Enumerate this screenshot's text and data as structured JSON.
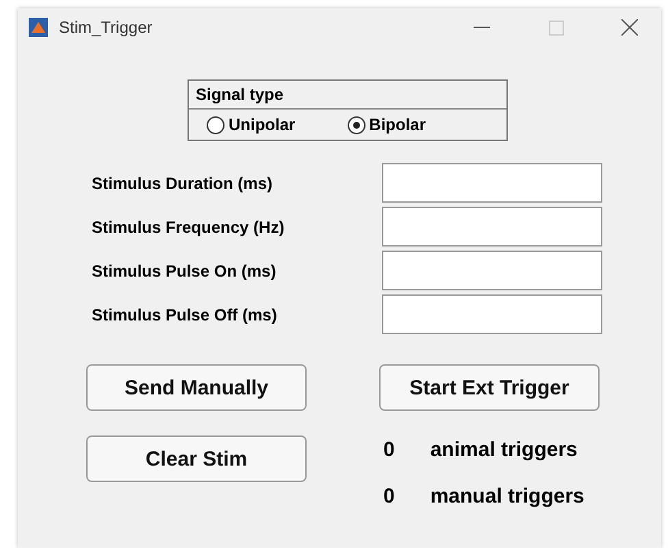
{
  "window": {
    "title": "Stim_Trigger"
  },
  "signal_type": {
    "title": "Signal type",
    "options": [
      {
        "label": "Unipolar",
        "selected": false
      },
      {
        "label": "Bipolar",
        "selected": true
      }
    ]
  },
  "fields": [
    {
      "label": "Stimulus Duration (ms)"
    },
    {
      "label": "Stimulus Frequency (Hz)"
    },
    {
      "label": "Stimulus Pulse On (ms)"
    },
    {
      "label": "Stimulus Pulse Off (ms)"
    }
  ],
  "buttons": {
    "send": "Send Manually",
    "start": "Start Ext Trigger",
    "clear": "Clear Stim"
  },
  "counters": [
    {
      "value": "0",
      "label": "animal triggers"
    },
    {
      "value": "0",
      "label": "manual triggers"
    }
  ]
}
